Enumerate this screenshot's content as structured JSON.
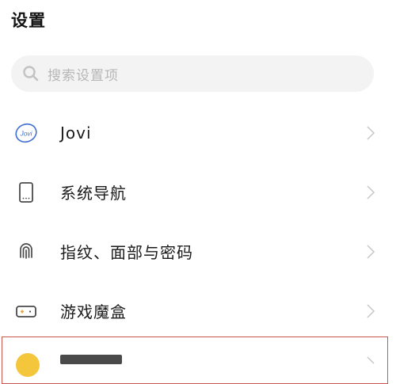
{
  "page": {
    "title": "设置"
  },
  "search": {
    "placeholder": "搜索设置项",
    "icon": "search-icon"
  },
  "settings": {
    "items": [
      {
        "label": "Jovi",
        "icon": "jovi-icon",
        "icon_text": "Jovi"
      },
      {
        "label": "系统导航",
        "icon": "phone-navigation-icon"
      },
      {
        "label": "指纹、面部与密码",
        "icon": "fingerprint-icon"
      },
      {
        "label": "游戏魔盒",
        "icon": "game-box-icon"
      }
    ]
  },
  "colors": {
    "background": "#ffffff",
    "search_background": "#f3f3f3",
    "placeholder_text": "#b7b7b7",
    "chevron": "#c7c7c7",
    "highlight_border": "#c9574f",
    "partial_icon": "#f3c63c",
    "jovi_icon": "#3f6fd1",
    "item_icon": "#4a4a4a"
  }
}
